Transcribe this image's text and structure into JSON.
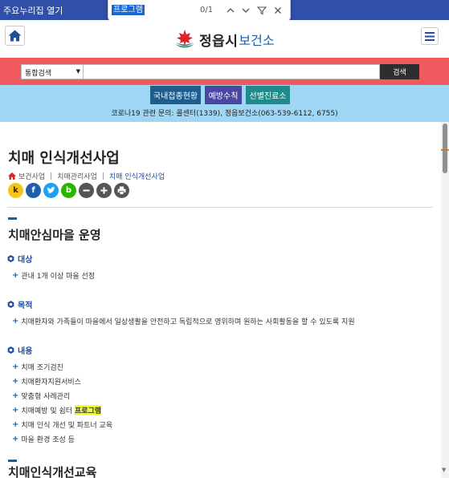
{
  "topbar": {
    "skip_link": "주요누리집 열기"
  },
  "findbar": {
    "query": "프로그램",
    "count": "0/1"
  },
  "header": {
    "logo_name": "정읍시",
    "logo_sub": "보건소"
  },
  "search": {
    "select_value": "통합검색",
    "input_value": "",
    "button": "검색"
  },
  "quick_links": [
    "국내접종현황",
    "예방수칙",
    "선별진료소"
  ],
  "hotline": "코로나19 관련 문의: 콜센터(1339), 정읍보건소(063-539-6112, 6755)",
  "page": {
    "title": "치매 인식개선사업",
    "breadcrumb": [
      "보건사업",
      "치매관리사업",
      "치매 인식개선사업"
    ]
  },
  "share": {
    "kakao": "k",
    "facebook": "f",
    "band": "b"
  },
  "sections": {
    "village": {
      "title": "치매안심마을 운영",
      "target_head": "대상",
      "target_items": [
        "관내 1개 이상 마을 선정"
      ],
      "purpose_head": "목적",
      "purpose_items": [
        "치매환자와 가족들이 마을에서 일상생활을 안전하고 독립적으로 영위하며 원하는 사회활동을 할 수 있도록 지원"
      ],
      "content_head": "내용",
      "content_items": [
        "치매 조기검진",
        "치매환자지원서비스",
        "맞춤형 사례관리",
        "치매예방 및 쉼터",
        "치매 인식 개선 및 파트너 교육",
        "마을 환경 조성 등"
      ],
      "highlight_word": "프로그램"
    },
    "education": {
      "title": "치매인식개선교육"
    }
  },
  "colors": {
    "topbar": "#2f4fa8",
    "search_band": "#f05a5e",
    "quick_band": "#9fd6f3",
    "quick_buttons": [
      "#1c5d8e",
      "#4a47a3",
      "#1f8a8a"
    ],
    "accent_blue": "#1f4ea0",
    "find_highlight": "#f5ff2a"
  },
  "icons": {
    "home": "home-icon",
    "menu": "hamburger-icon",
    "logo": "maple-leaf-logo",
    "find_up": "chevron-up-icon",
    "find_down": "chevron-down-icon",
    "find_filter": "filter-icon",
    "find_close": "close-icon",
    "zoom_out": "minus-icon",
    "zoom_in": "plus-icon",
    "print": "print-icon",
    "breadcrumb_home": "home-icon",
    "section_bullet": "hexagon-bullet-icon",
    "list_bullet": "plus-bullet-icon"
  }
}
